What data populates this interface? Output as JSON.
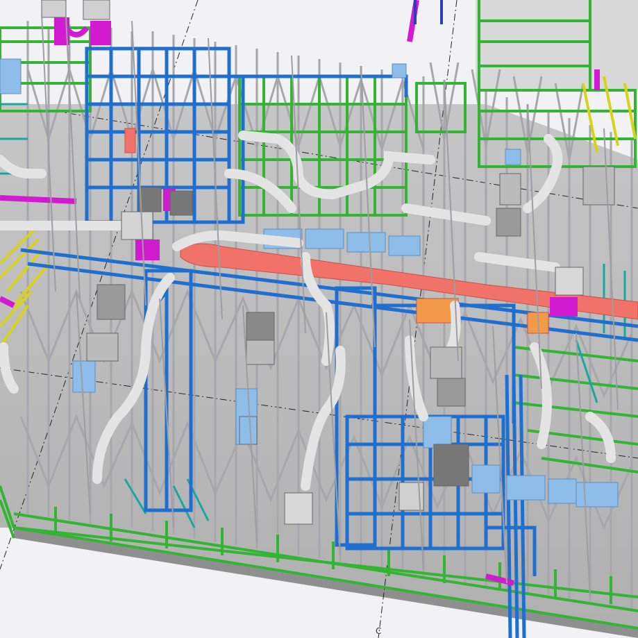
{
  "viewport": {
    "kind": "3d-bim-model-view",
    "grid_label": "C",
    "colors": {
      "background": "#f2f2f4",
      "slab": "#b9b9b9",
      "slab_edge": "#8f8f8f",
      "truss": "#a9a9ad",
      "steel_blue": "#1f6fd0",
      "steel_green": "#33b533",
      "steel_teal": "#1aa6a0",
      "steel_yellow": "#d9d21a",
      "duct_white": "#e4e4e4",
      "duct_lightblue": "#8dbde8",
      "duct_red": "#f07268",
      "duct_orange": "#f39a4a",
      "pipe_magenta": "#d21bd0",
      "equipment_gray": "#8a8a8a",
      "grid_line": "#222222"
    },
    "layers": [
      "floor-slab",
      "steel-framing-blue",
      "steel-framing-green",
      "roof-trusses",
      "supply-ducts",
      "return-ducts",
      "exhaust-ducts",
      "piping",
      "equipment",
      "grid-lines"
    ]
  }
}
